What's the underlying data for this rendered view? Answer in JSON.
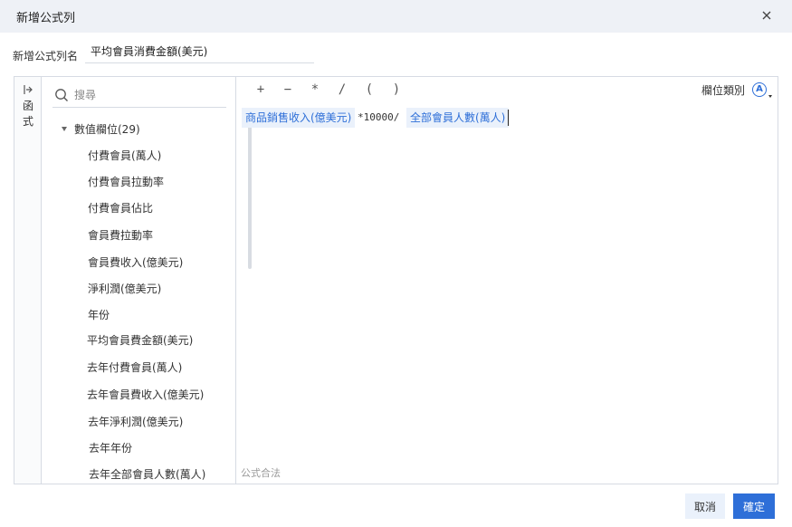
{
  "dialog": {
    "title": "新增公式列",
    "close_icon": "close-icon"
  },
  "name_row": {
    "label": "新增公式列名",
    "value": "平均會員消費金額(美元)"
  },
  "func_rail": {
    "expand_icon": "expand-arrow-icon",
    "label_line1": "函",
    "label_line2": "式"
  },
  "field_panel": {
    "search_placeholder": "搜尋",
    "group_label": "數值欄位(29)",
    "items": [
      "付費會員(萬人)",
      "付費會員拉動率",
      "付費會員佔比",
      "會員費拉動率",
      "會員費收入(億美元)",
      "淨利潤(億美元)",
      "年份",
      "平均會員費金額(美元)",
      "去年付費會員(萬人)",
      "去年會員費收入(億美元)",
      "去年淨利潤(億美元)",
      "去年年份",
      "去年全部會員人數(萬人)"
    ]
  },
  "toolbar": {
    "ops": [
      "+",
      "−",
      "*",
      "/",
      "(",
      ")"
    ],
    "type_label": "欄位類別",
    "type_icon_text": "A"
  },
  "formula": {
    "chip1": "商品銷售收入(億美元)",
    "operator": "*10000/",
    "chip2": "全部會員人數(萬人)"
  },
  "status": {
    "valid_text": "公式合法"
  },
  "footer": {
    "cancel_label": "取消",
    "ok_label": "確定"
  },
  "colors": {
    "accent": "#2e6fd8",
    "chip_bg": "#eaf1fb",
    "header_bg": "#eef1f6",
    "border": "#d6dbe3"
  }
}
